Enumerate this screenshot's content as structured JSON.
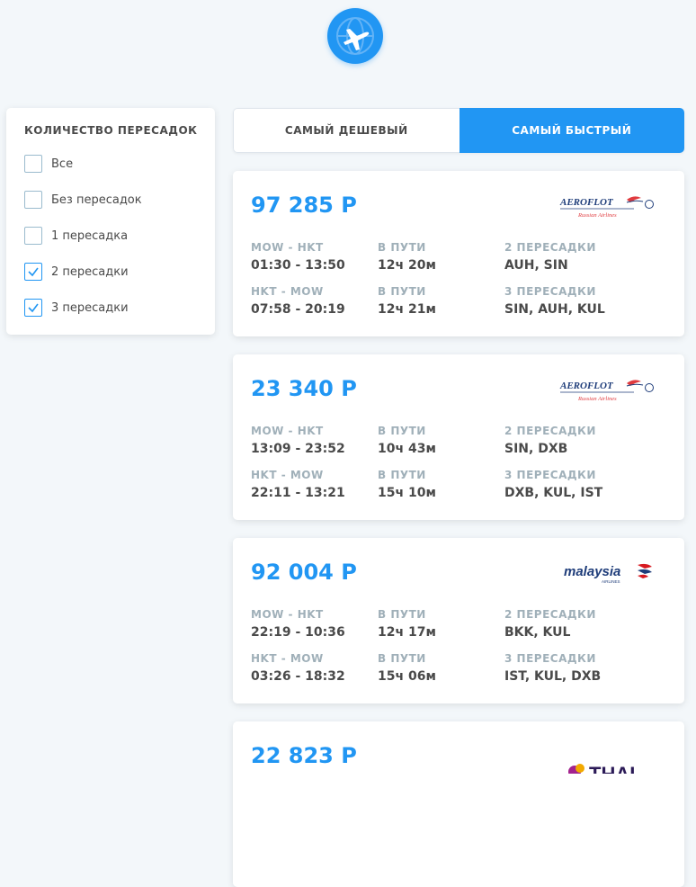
{
  "app": {
    "logo_icon": "airplane-globe-icon",
    "accent_color": "#2196f3"
  },
  "filters": {
    "title": "Количество пересадок",
    "items": [
      {
        "label": "Все",
        "checked": false
      },
      {
        "label": "Без пересадок",
        "checked": false
      },
      {
        "label": "1 пересадка",
        "checked": false
      },
      {
        "label": "2 пересадки",
        "checked": true
      },
      {
        "label": "3 пересадки",
        "checked": true
      }
    ]
  },
  "tabs": [
    {
      "label": "Самый дешевый",
      "active": false
    },
    {
      "label": "Самый быстрый",
      "active": true
    }
  ],
  "tickets": [
    {
      "price": "97 285 Р",
      "carrier": "aeroflot-logo",
      "carrier_text": "AEROFLOT",
      "carrier_sub": "Russian Airlines",
      "segments": [
        {
          "route": "MOW - HKT",
          "time": "01:30 - 13:50",
          "duration_label": "В пути",
          "duration": "12ч 20м",
          "stops_label": "2 пересадки",
          "stops": "AUH, SIN"
        },
        {
          "route": "HKT - MOW",
          "time": "07:58 - 20:19",
          "duration_label": "В пути",
          "duration": "12ч 21м",
          "stops_label": "3 пересадки",
          "stops": "SIN, AUH, KUL"
        }
      ]
    },
    {
      "price": "23 340 Р",
      "carrier": "aeroflot-logo",
      "carrier_text": "AEROFLOT",
      "carrier_sub": "Russian Airlines",
      "segments": [
        {
          "route": "MOW - HKT",
          "time": "13:09 - 23:52",
          "duration_label": "В пути",
          "duration": "10ч 43м",
          "stops_label": "2 пересадки",
          "stops": "SIN, DXB"
        },
        {
          "route": "HKT - MOW",
          "time": "22:11 - 13:21",
          "duration_label": "В пути",
          "duration": "15ч 10м",
          "stops_label": "3 пересадки",
          "stops": "DXB, KUL, IST"
        }
      ]
    },
    {
      "price": "92 004 Р",
      "carrier": "malaysia-logo",
      "carrier_text": "malaysia",
      "carrier_sub": "AIRLINES",
      "segments": [
        {
          "route": "MOW - HKT",
          "time": "22:19 - 10:36",
          "duration_label": "В пути",
          "duration": "12ч 17м",
          "stops_label": "2 пересадки",
          "stops": "BKK, KUL"
        },
        {
          "route": "HKT - MOW",
          "time": "03:26 - 18:32",
          "duration_label": "В пути",
          "duration": "15ч 06м",
          "stops_label": "3 пересадки",
          "stops": "IST, KUL, DXB"
        }
      ]
    },
    {
      "price": "22 823 Р",
      "carrier": "thai-logo",
      "carrier_text": "THAI",
      "segments": []
    }
  ]
}
